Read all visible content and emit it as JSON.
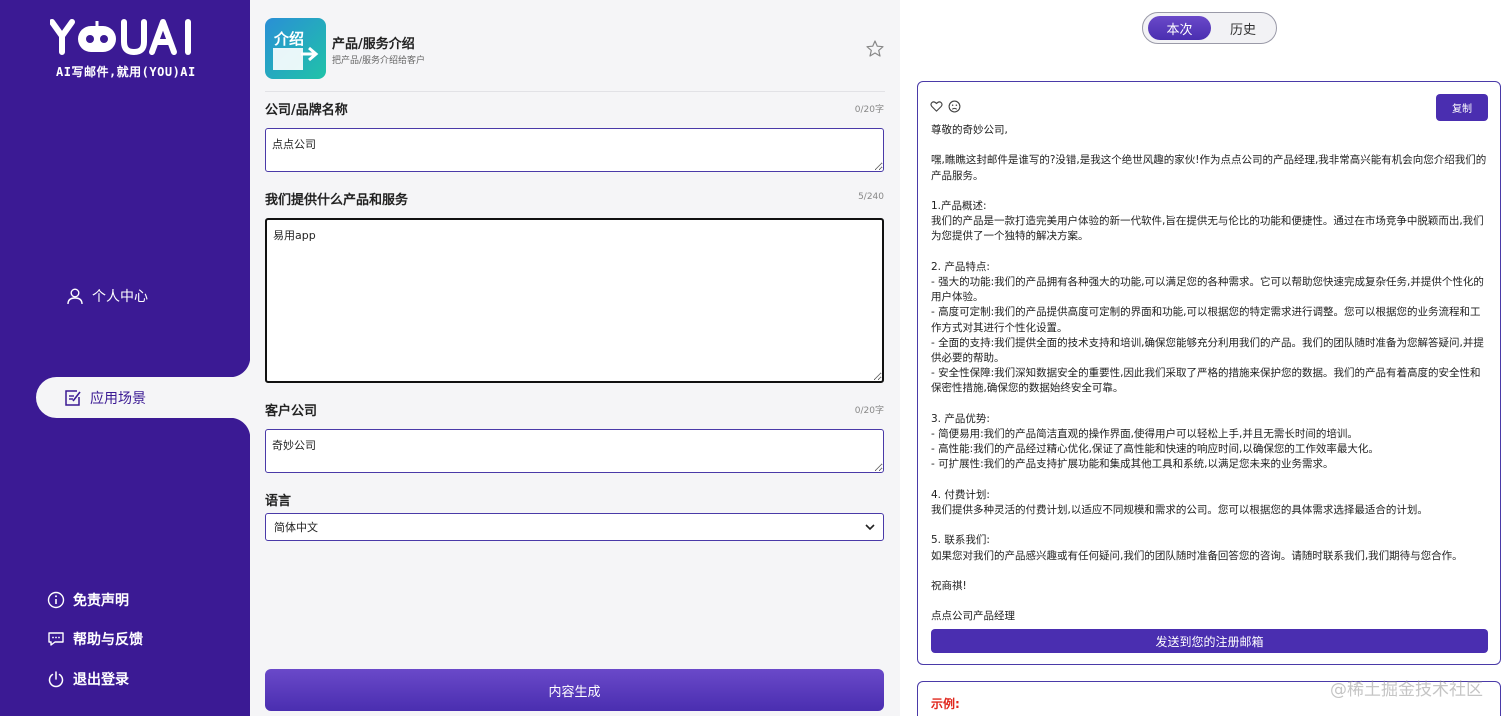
{
  "sidebar": {
    "logo_text": "YOUAI",
    "slogan": "AI写邮件,就用(YOU)AI",
    "personal_center": "个人中心",
    "scenarios": "应用场景",
    "disclaimer": "免责声明",
    "help": "帮助与反馈",
    "logout": "退出登录"
  },
  "app": {
    "title": "产品/服务介绍",
    "subtitle": "把产品/服务介绍给客户",
    "icon_text": "介绍"
  },
  "form": {
    "company_label": "公司/品牌名称",
    "company_count": "0/20字",
    "company_value": "点点公司",
    "product_label": "我们提供什么产品和服务",
    "product_count": "5/240",
    "product_value": "易用app",
    "client_label": "客户公司",
    "client_count": "0/20字",
    "client_value": "奇妙公司",
    "language_label": "语言",
    "language_value": "简体中文",
    "generate": "内容生成"
  },
  "tabs": {
    "current": "本次",
    "history": "历史"
  },
  "result": {
    "copy": "复制",
    "send": "发送到您的注册邮箱",
    "lines": [
      "尊敬的奇妙公司,",
      "",
      "嘿,瞧瞧这封邮件是谁写的?没错,是我这个绝世风趣的家伙!作为点点公司的产品经理,我非常高兴能有机会向您介绍我们的产品服务。",
      "",
      "1.产品概述:",
      "我们的产品是一款打造完美用户体验的新一代软件,旨在提供无与伦比的功能和便捷性。通过在市场竞争中脱颖而出,我们为您提供了一个独特的解决方案。",
      "",
      "2. 产品特点:",
      "- 强大的功能:我们的产品拥有各种强大的功能,可以满足您的各种需求。它可以帮助您快速完成复杂任务,并提供个性化的用户体验。",
      "- 高度可定制:我们的产品提供高度可定制的界面和功能,可以根据您的特定需求进行调整。您可以根据您的业务流程和工作方式对其进行个性化设置。",
      "- 全面的支持:我们提供全面的技术支持和培训,确保您能够充分利用我们的产品。我们的团队随时准备为您解答疑问,并提供必要的帮助。",
      "- 安全性保障:我们深知数据安全的重要性,因此我们采取了严格的措施来保护您的数据。我们的产品有着高度的安全性和保密性措施,确保您的数据始终安全可靠。",
      "",
      "3. 产品优势:",
      "- 简便易用:我们的产品简洁直观的操作界面,使得用户可以轻松上手,并且无需长时间的培训。",
      "- 高性能:我们的产品经过精心优化,保证了高性能和快速的响应时间,以确保您的工作效率最大化。",
      "- 可扩展性:我们的产品支持扩展功能和集成其他工具和系统,以满足您未来的业务需求。",
      "",
      "4. 付费计划:",
      "我们提供多种灵活的付费计划,以适应不同规模和需求的公司。您可以根据您的具体需求选择最适合的计划。",
      "",
      "5. 联系我们:",
      "如果您对我们的产品感兴趣或有任何疑问,我们的团队随时准备回答您的咨询。请随时联系我们,我们期待与您合作。",
      "",
      "祝商祺!",
      "",
      "点点公司产品经理"
    ]
  },
  "example": {
    "label": "示例:"
  },
  "watermark": "@稀土掘金技术社区",
  "colors": {
    "sidebar": "#3b1a94",
    "accent": "#4a2eb0",
    "example_red": "#e0281e"
  }
}
